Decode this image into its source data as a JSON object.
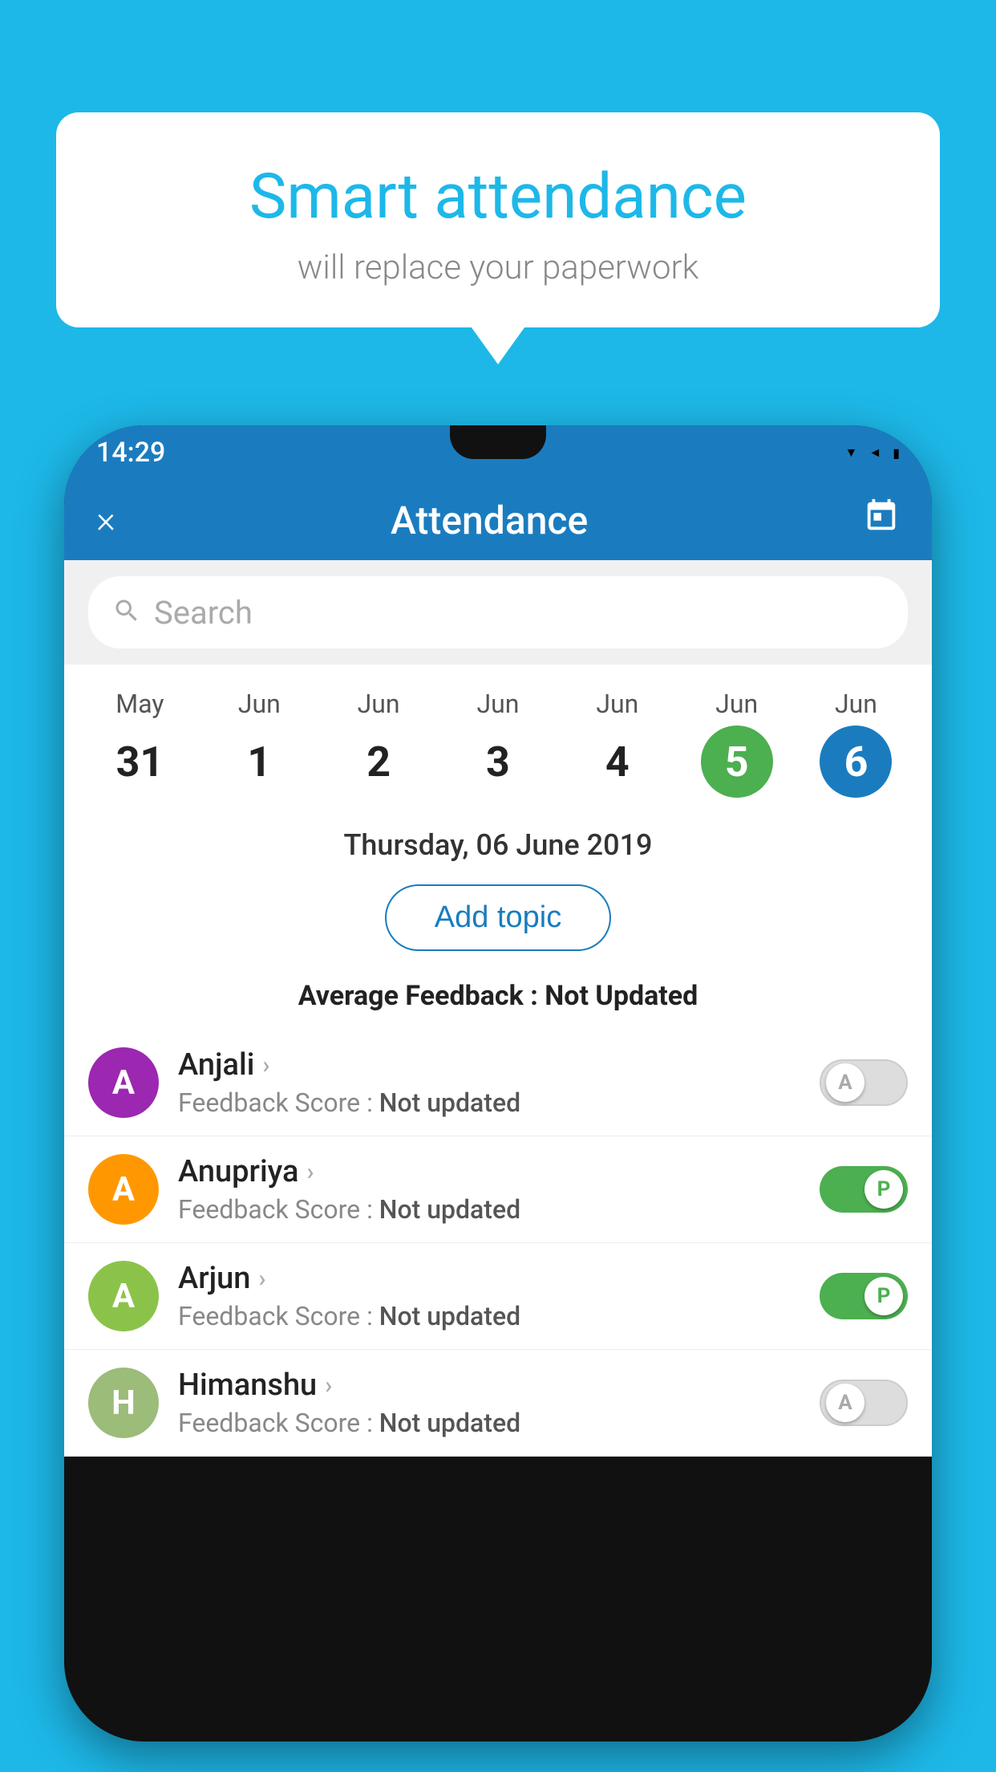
{
  "background_color": "#1db8e8",
  "bubble": {
    "title": "Smart attendance",
    "subtitle": "will replace your paperwork"
  },
  "status_bar": {
    "time": "14:29",
    "icons": [
      "wifi",
      "signal",
      "battery"
    ]
  },
  "header": {
    "title": "Attendance",
    "close_label": "×",
    "calendar_label": "📅"
  },
  "search": {
    "placeholder": "Search"
  },
  "calendar": {
    "days": [
      {
        "month": "May",
        "num": "31",
        "style": "normal"
      },
      {
        "month": "Jun",
        "num": "1",
        "style": "normal"
      },
      {
        "month": "Jun",
        "num": "2",
        "style": "normal"
      },
      {
        "month": "Jun",
        "num": "3",
        "style": "normal"
      },
      {
        "month": "Jun",
        "num": "4",
        "style": "normal"
      },
      {
        "month": "Jun",
        "num": "5",
        "style": "green"
      },
      {
        "month": "Jun",
        "num": "6",
        "style": "blue"
      }
    ]
  },
  "selected_date": "Thursday, 06 June 2019",
  "add_topic_label": "Add topic",
  "avg_feedback": {
    "label": "Average Feedback : ",
    "value": "Not Updated"
  },
  "students": [
    {
      "name": "Anjali",
      "avatar_letter": "A",
      "avatar_class": "avatar-purple",
      "feedback": "Feedback Score : ",
      "feedback_value": "Not updated",
      "toggle": "off",
      "toggle_letter": "A"
    },
    {
      "name": "Anupriya",
      "avatar_letter": "A",
      "avatar_class": "avatar-orange",
      "feedback": "Feedback Score : ",
      "feedback_value": "Not updated",
      "toggle": "on",
      "toggle_letter": "P"
    },
    {
      "name": "Arjun",
      "avatar_letter": "A",
      "avatar_class": "avatar-lightgreen",
      "feedback": "Feedback Score : ",
      "feedback_value": "Not updated",
      "toggle": "on",
      "toggle_letter": "P"
    },
    {
      "name": "Himanshu",
      "avatar_letter": "H",
      "avatar_class": "avatar-teal",
      "feedback": "Feedback Score : ",
      "feedback_value": "Not updated",
      "toggle": "off",
      "toggle_letter": "A"
    }
  ]
}
